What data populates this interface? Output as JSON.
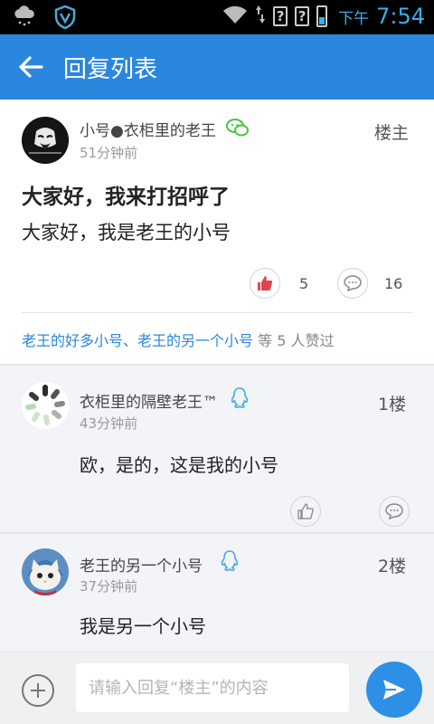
{
  "status_bar": {
    "ampm": "下午",
    "time": "7:54",
    "sim1": "?",
    "sim2": "?",
    "icons": [
      "weather-rain-icon",
      "shield-v-icon",
      "wifi-icon",
      "data-arrows-icon",
      "battery-icon"
    ]
  },
  "app_bar": {
    "title": "回复列表",
    "back_icon": "arrow-left-icon",
    "color": "#2b87de"
  },
  "main_post": {
    "author": "小号●衣柜里的老王",
    "source_icon": "wechat-icon",
    "time": "51分钟前",
    "floor": "楼主",
    "title": "大家好，我来打招呼了",
    "body": "大家好，我是老王的小号",
    "like_count": "5",
    "comment_count": "16",
    "liked": true,
    "likers": {
      "user1": "老王的好多小号",
      "separator": "、",
      "user2": "老王的另一个小号",
      "suffix": " 等 5 人赞过"
    }
  },
  "replies": [
    {
      "author": "衣柜里的隔壁老王™",
      "source_icon": "qq-icon",
      "time": "43分钟前",
      "floor": "1楼",
      "text": "欧，是的，这是我的小号"
    },
    {
      "author": "老王的另一个小号",
      "source_icon": "qq-icon",
      "time": "37分钟前",
      "floor": "2楼",
      "text": "我是另一个小号"
    }
  ],
  "composer": {
    "placeholder": "请输入回复“楼主”的内容",
    "value": "",
    "send_color": "#2d8fe6"
  }
}
